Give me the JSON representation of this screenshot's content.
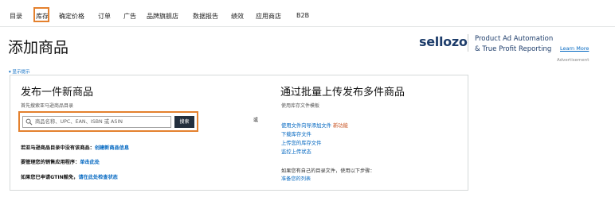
{
  "nav": {
    "items": [
      "目录",
      "库存",
      "确定价格",
      "订单",
      "广告",
      "品牌旗舰店",
      "数据报告",
      "绩效",
      "应用商店",
      "B2B"
    ]
  },
  "page": {
    "title": "添加商品"
  },
  "ad": {
    "logo": "sellozo",
    "line1": "Product Ad Automation",
    "line2": "& True Profit Reporting",
    "learn_more": "Learn More",
    "tag": "Advertisement"
  },
  "show_tips": "▾ 显示提示",
  "left": {
    "title": "发布一件新商品",
    "subtitle": "首先搜索亚马逊商品目录",
    "search_placeholder": "商品名称、UPC、EAN、ISBN 或 ASIN",
    "search_button": "搜索",
    "info1_text": "若亚马逊商品目录中没有该商品：",
    "info1_link": "创建新商品信息",
    "info2_text": "要管理您的销售应用程序：",
    "info2_link": "单击此处",
    "info3_text": "如果您已申请GTIN豁免，",
    "info3_link": "请在此处检查状态"
  },
  "or_label": "或",
  "right": {
    "title": "通过批量上传发布多件商品",
    "subtitle": "使用库存文件模板",
    "link1": "使用文件向导添加文件",
    "link1_badge": "新功能",
    "link2": "下载库存文件",
    "link3": "上传您的库存文件",
    "link4": "监控上传状态",
    "note": "如果您有自己的目录文件，使用以下步骤：",
    "note_link": "准备您的列表"
  },
  "colors": {
    "highlight": "#e4812e",
    "link": "#0066c0",
    "button": "#232f3e",
    "brand": "#1e3d6b"
  }
}
